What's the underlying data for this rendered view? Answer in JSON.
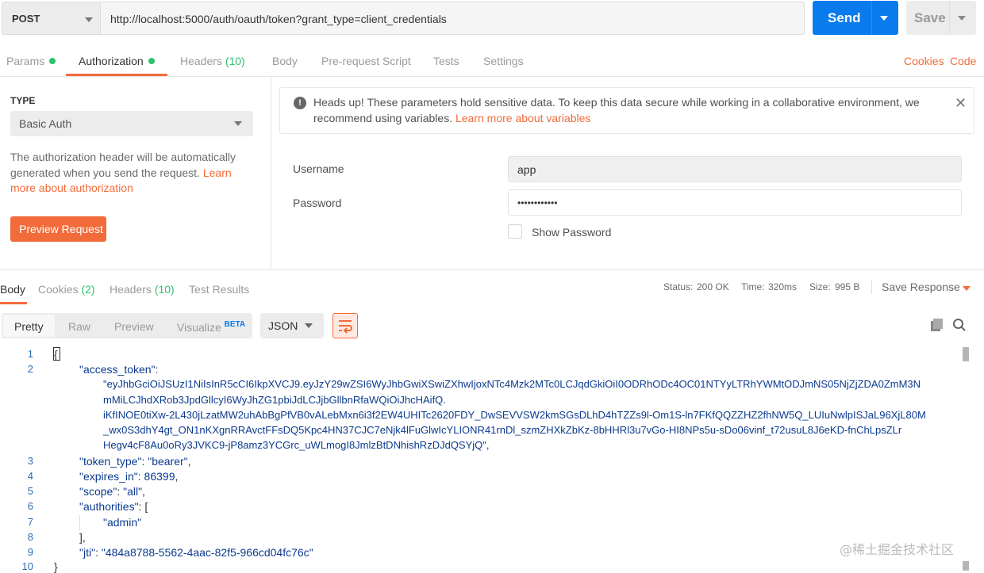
{
  "request": {
    "method": "POST",
    "url": "http://localhost:5000/auth/oauth/token?grant_type=client_credentials",
    "send_label": "Send",
    "save_label": "Save"
  },
  "request_tabs": [
    {
      "label": "Params"
    },
    {
      "label": "Authorization"
    },
    {
      "label": "Headers",
      "count": "(10)"
    },
    {
      "label": "Body"
    },
    {
      "label": "Pre-request Script"
    },
    {
      "label": "Tests"
    },
    {
      "label": "Settings"
    }
  ],
  "links": {
    "cookies": "Cookies",
    "code": "Code"
  },
  "auth": {
    "type_header": "TYPE",
    "type_value": "Basic Auth",
    "description": "The authorization header will be automatically generated when you send the request. ",
    "learn_more": "Learn more about authorization",
    "preview_button": "Preview Request",
    "alert_text": "Heads up! These parameters hold sensitive data. To keep this data secure while working in a collaborative environment, we recommend using variables. ",
    "alert_link": "Learn more about variables",
    "username_label": "Username",
    "username_value": "app",
    "password_label": "Password",
    "password_value": "••••••••••••",
    "show_password_label": "Show Password"
  },
  "response_tabs": [
    {
      "label": "Body"
    },
    {
      "label": "Cookies",
      "count": "(2)"
    },
    {
      "label": "Headers",
      "count": "(10)"
    },
    {
      "label": "Test Results"
    }
  ],
  "status": {
    "status_label": "Status:",
    "status_value": "200 OK",
    "time_label": "Time:",
    "time_value": "320ms",
    "size_label": "Size:",
    "size_value": "995 B",
    "save_response": "Save Response"
  },
  "view_modes": [
    "Pretty",
    "Raw",
    "Preview",
    "Visualize"
  ],
  "beta_label": "BETA",
  "format": "JSON",
  "code": {
    "line_numbers": [
      "1",
      "2",
      "3",
      "4",
      "5",
      "6",
      "7",
      "8",
      "9",
      "10"
    ],
    "lines": {
      "l1": "{",
      "l2_key": "\"access_token\"",
      "token_1": "\"eyJhbGciOiJSUzI1NiIsInR5cCI6IkpXVCJ9.eyJzY29wZSI6WyJhbGwiXSwiZXhwIjoxNTc4Mzk2MTc0LCJqdGkiOiI0ODRhODc4OC01NTYyLTRhYWMtODJmNS05NjZjZDA0ZmM3N",
      "token_2": "mMiLCJhdXRob3JpdGllcyI6WyJhZG1pbiJdLCJjbGllbnRfaWQiOiJhcHAifQ.",
      "token_3": "iKfINOE0tiXw-2L430jLzatMW2uhAbBgPfVB0vALebMxn6i3f2EW4UHITc2620FDY_DwSEVVSW2kmSGsDLhD4hTZZs9l-Om1S-ln7FKfQQZZHZ2fhNW5Q_LUIuNwlpISJaL96XjL80M",
      "token_4": "_wx0S3dhY4gt_ON1nKXgnRRAvctFFsDQ5Kpc4HN37CJC7eNjk4lFuGlwIcYLIONR41rnDl_szmZHXkZbKz-8bHHRl3u7vGo-HI8NPs5u-sDo06vinf_t72usuL8J6eKD-fnChLpsZLr",
      "token_5": "Hegv4cF8Au0oRy3JVKC9-jP8amz3YCGrc_uWLmogI8JmlzBtDNhishRzDJdQSYjQ\",",
      "l3_key": "\"token_type\"",
      "l3_val": "\"bearer\"",
      "l4_key": "\"expires_in\"",
      "l4_val": "86399",
      "l5_key": "\"scope\"",
      "l5_val": "\"all\"",
      "l6_key": "\"authorities\"",
      "l6_val": "[",
      "l7_val": "\"admin\"",
      "l8": "],",
      "l9_key": "\"jti\"",
      "l9_val": "\"484a8788-5562-4aac-82f5-966cd04fc76c\"",
      "l10": "}"
    }
  },
  "watermark": "@稀土掘金技术社区"
}
